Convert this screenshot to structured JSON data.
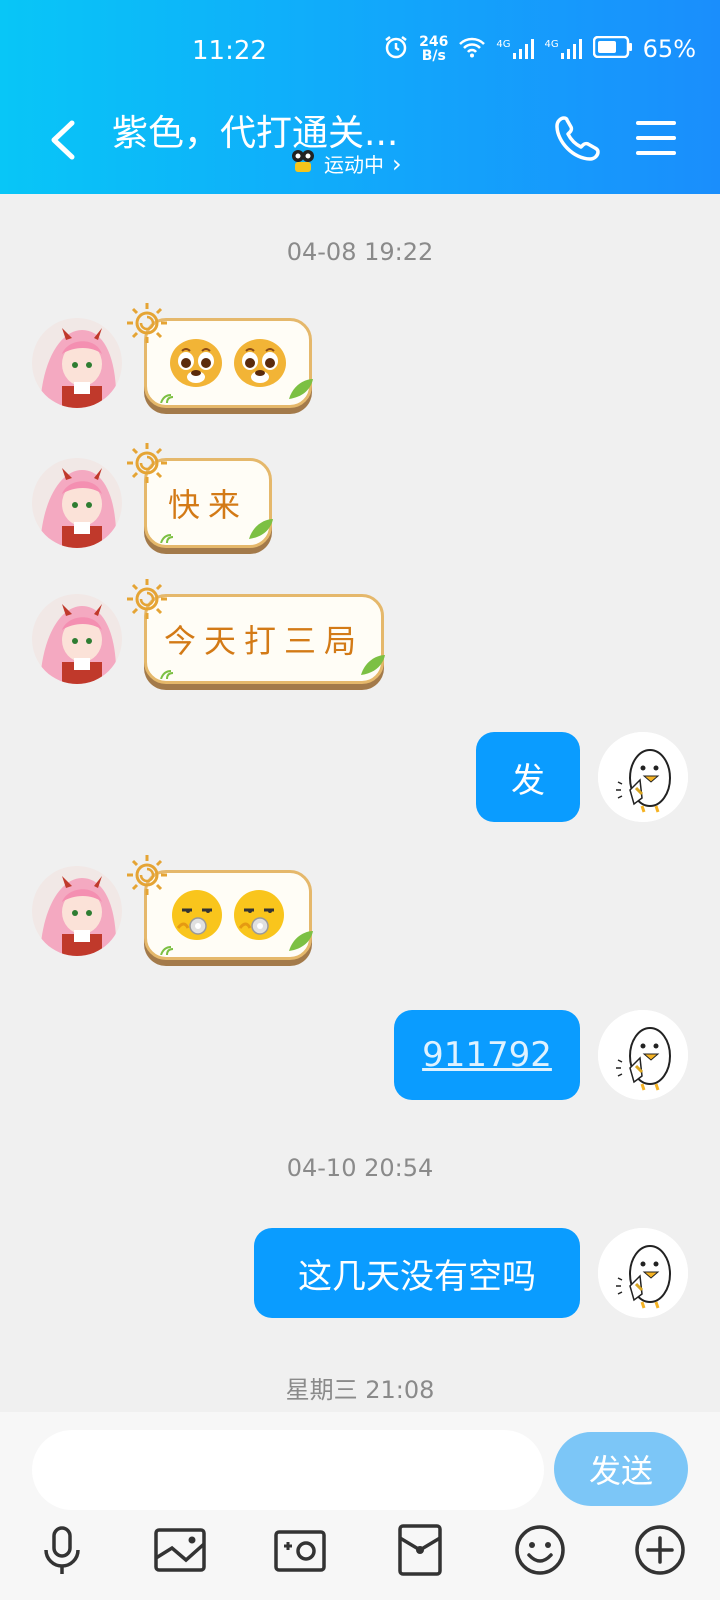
{
  "status_bar": {
    "time": "11:22",
    "net_speed_value": "246",
    "net_speed_unit": "B/s",
    "network_1": "4G",
    "network_2": "4G",
    "battery": "65%"
  },
  "header": {
    "title": "紫色，代打通关...",
    "subtitle": "运动中",
    "subtitle_arrow": "›"
  },
  "messages": {
    "ts1": "04-08 19:22",
    "m2_text": "快来",
    "m3_text": "今天打三局",
    "m4_text": "发",
    "m6_link": "911792",
    "ts2": "04-10 20:54",
    "m7_text": "这几天没有空吗",
    "ts3": "星期三 21:08"
  },
  "input": {
    "placeholder": "",
    "send_label": "发送"
  },
  "colors": {
    "header_start": "#08c6f7",
    "header_end": "#1a8efc",
    "bubble_blue": "#0a9cff",
    "send_disabled": "#7cc6f7"
  }
}
